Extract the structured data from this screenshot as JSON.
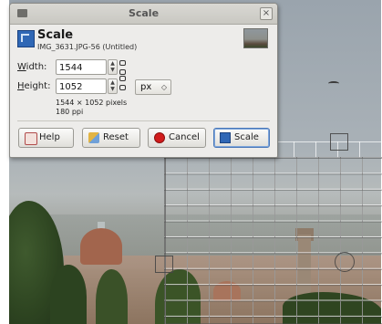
{
  "dialog": {
    "window_title": "Scale",
    "close_glyph": "×",
    "heading": "Scale",
    "subtitle": "IMG_3631.JPG-56 (Untitled)",
    "width_label_pre": "W",
    "width_label_post": "idth:",
    "width_value": "1544",
    "height_label_pre": "H",
    "height_label_post": "eight:",
    "height_value": "1052",
    "unit": "px",
    "info_pixels": "1544 × 1052 pixels",
    "info_ppi": "180 ppi",
    "buttons": {
      "help": "Help",
      "reset": "Reset",
      "cancel": "Cancel",
      "scale": "Scale"
    }
  },
  "icons": {
    "menu": "window-menu-icon",
    "close": "close-icon",
    "scale": "scale-icon",
    "chain": "chain-link-icon",
    "help": "help-icon",
    "reset": "reset-icon",
    "cancel": "cancel-icon"
  },
  "colors": {
    "accent": "#2f67b5",
    "cancel_red": "#d11c1c"
  }
}
